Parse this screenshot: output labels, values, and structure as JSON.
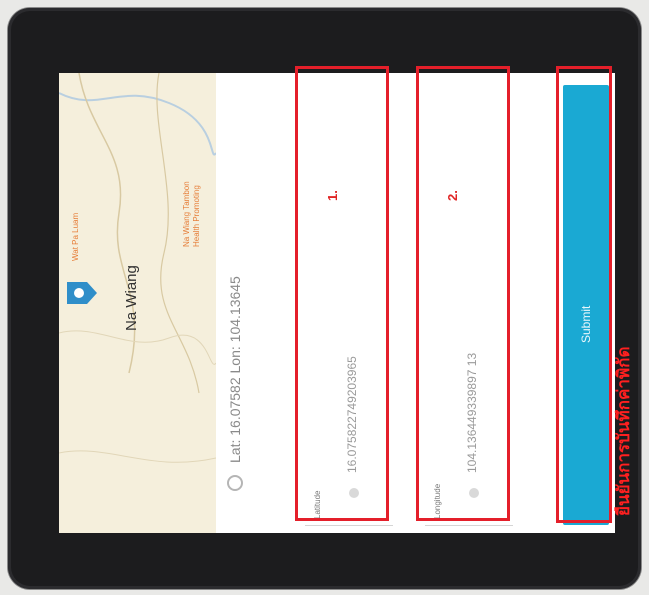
{
  "map": {
    "place_name": "Na Wiang",
    "poi_label": "Wat Pa Luam",
    "poi_orange_line1": "Na Wiang Tambon",
    "poi_orange_line2": "Health Promoting",
    "pin_color": "#2f8ec9"
  },
  "location": {
    "latlon_text": "Lat: 16.07582  Lon: 104.13645"
  },
  "fields": [
    {
      "label": "Latitude",
      "value": "16.075822749203965",
      "annotation": "1."
    },
    {
      "label": "Longitude",
      "value": "104.136449339897 13",
      "annotation": "2."
    }
  ],
  "submit": {
    "label": "Submit",
    "color": "#1aa9d3"
  },
  "annotation": {
    "thai_text": "ยืนยันการบันทึกค่าพิกัด",
    "color": "#e41f2a"
  }
}
